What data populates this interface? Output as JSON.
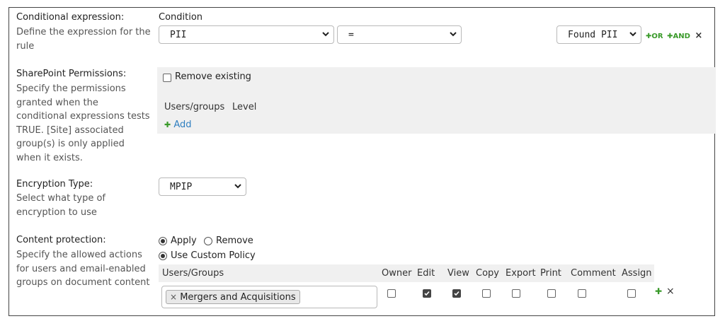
{
  "conditional": {
    "title": "Conditional expression:",
    "desc": "Define the expression for the rule",
    "condition_label": "Condition",
    "field_select": "PII",
    "operator_select": "=",
    "value_select": "Found PII",
    "or_label": "OR",
    "and_label": "AND",
    "remove_symbol": "×"
  },
  "sharepoint": {
    "title": "SharePoint Permissions:",
    "desc": "Specify the permissions granted when the conditional expressions tests TRUE. [Site] associated group(s) is only applied when it exists.",
    "remove_existing_label": "Remove existing",
    "remove_existing_checked": false,
    "columns": [
      "Users/groups",
      "Level"
    ],
    "add_label": "Add"
  },
  "encryption": {
    "title": "Encryption Type:",
    "desc": "Select what type of encryption to use",
    "selected": "MPIP"
  },
  "content_protection": {
    "title": "Content protection:",
    "desc": "Specify the allowed actions for users and email-enabled groups on document content",
    "apply_label": "Apply",
    "remove_label": "Remove",
    "mode": "Apply",
    "use_custom_policy_label": "Use Custom Policy",
    "use_custom_policy_selected": true,
    "columns": [
      "Users/Groups",
      "Owner",
      "Edit",
      "View",
      "Copy",
      "Export",
      "Print",
      "Comment",
      "Assign"
    ],
    "rows": [
      {
        "user_tag": "Mergers and Acquisitions",
        "tag_remove": "×",
        "owner": false,
        "edit": true,
        "view": true,
        "copy": false,
        "export": false,
        "print": false,
        "comment": false,
        "assign": false
      }
    ],
    "row_remove_symbol": "×"
  },
  "colors": {
    "green_plus": "#3a9a2a",
    "link_blue": "#2f7fc0",
    "panel_grey": "#f0f0f0",
    "border": "#444444"
  }
}
